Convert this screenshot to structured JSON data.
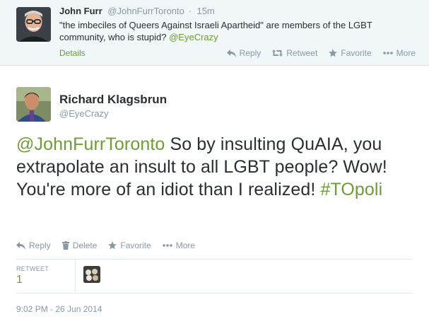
{
  "parent_tweet": {
    "fullname": "John Furr",
    "handle": "@JohnFurrToronto",
    "separator": "·",
    "time": "15m",
    "text_main": "\"the imbeciles of Queers Against Israeli Apartheid\" are members of the LGBT community, who is stupid? ",
    "mention": "@EyeCrazy",
    "details": "Details",
    "actions": {
      "reply": "Reply",
      "retweet": "Retweet",
      "favorite": "Favorite",
      "more": "More"
    }
  },
  "main_tweet": {
    "fullname": "Richard Klagsbrun",
    "handle": "@EyeCrazy",
    "mention": "@JohnFurrToronto",
    "text_main": " So by insulting QuAIA, you extrapolate an insult to all LGBT people? Wow! You're more of an idiot than I realized! ",
    "hashtag": "#TOpoli",
    "actions": {
      "reply": "Reply",
      "delete": "Delete",
      "favorite": "Favorite",
      "more": "More"
    },
    "stats": {
      "label": "RETWEET",
      "count": "1"
    },
    "timestamp": "9:02 PM - 26 Jun 2014"
  },
  "colors": {
    "link": "#6d9e32",
    "muted": "#8899a6",
    "text": "#292f33",
    "parent_bg": "#f1f6f8"
  },
  "icons": [
    "reply-icon",
    "retweet-icon",
    "favorite-star-icon",
    "more-dots-icon",
    "trash-icon"
  ]
}
